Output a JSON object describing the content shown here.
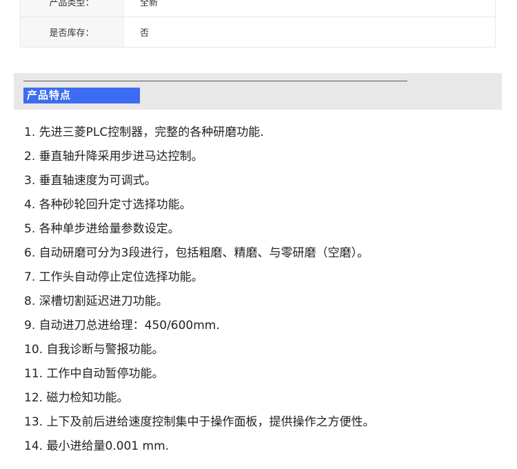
{
  "spec_table": {
    "rows": [
      {
        "key": "产品类型：",
        "value": "全新"
      },
      {
        "key": "是否库存：",
        "value": "否"
      }
    ]
  },
  "section": {
    "title": "产品特点"
  },
  "features": [
    "1. 先进三菱PLC控制器，完整的各种研磨功能.",
    "2. 垂直轴升降采用步进马达控制。",
    "3. 垂直轴速度为可调式。",
    "4. 各种砂轮回升定寸选择功能。",
    "5. 各种单步进给量参数设定。",
    "6. 自动研磨可分为3段进行，包括粗磨、精磨、与零研磨（空磨）。",
    "7. 工作头自动停止定位选择功能。",
    "8. 深槽切割延迟进刀功能。",
    "9. 自动进刀总进给理：450/600mm.",
    "10. 自我诊断与警报功能。",
    "11. 工作中自动暂停功能。",
    "12. 磁力检知功能。",
    "13. 上下及前后进给速度控制集中于操作面板，提供操作之方便性。",
    "14. 最小进给量0.001 mm."
  ]
}
